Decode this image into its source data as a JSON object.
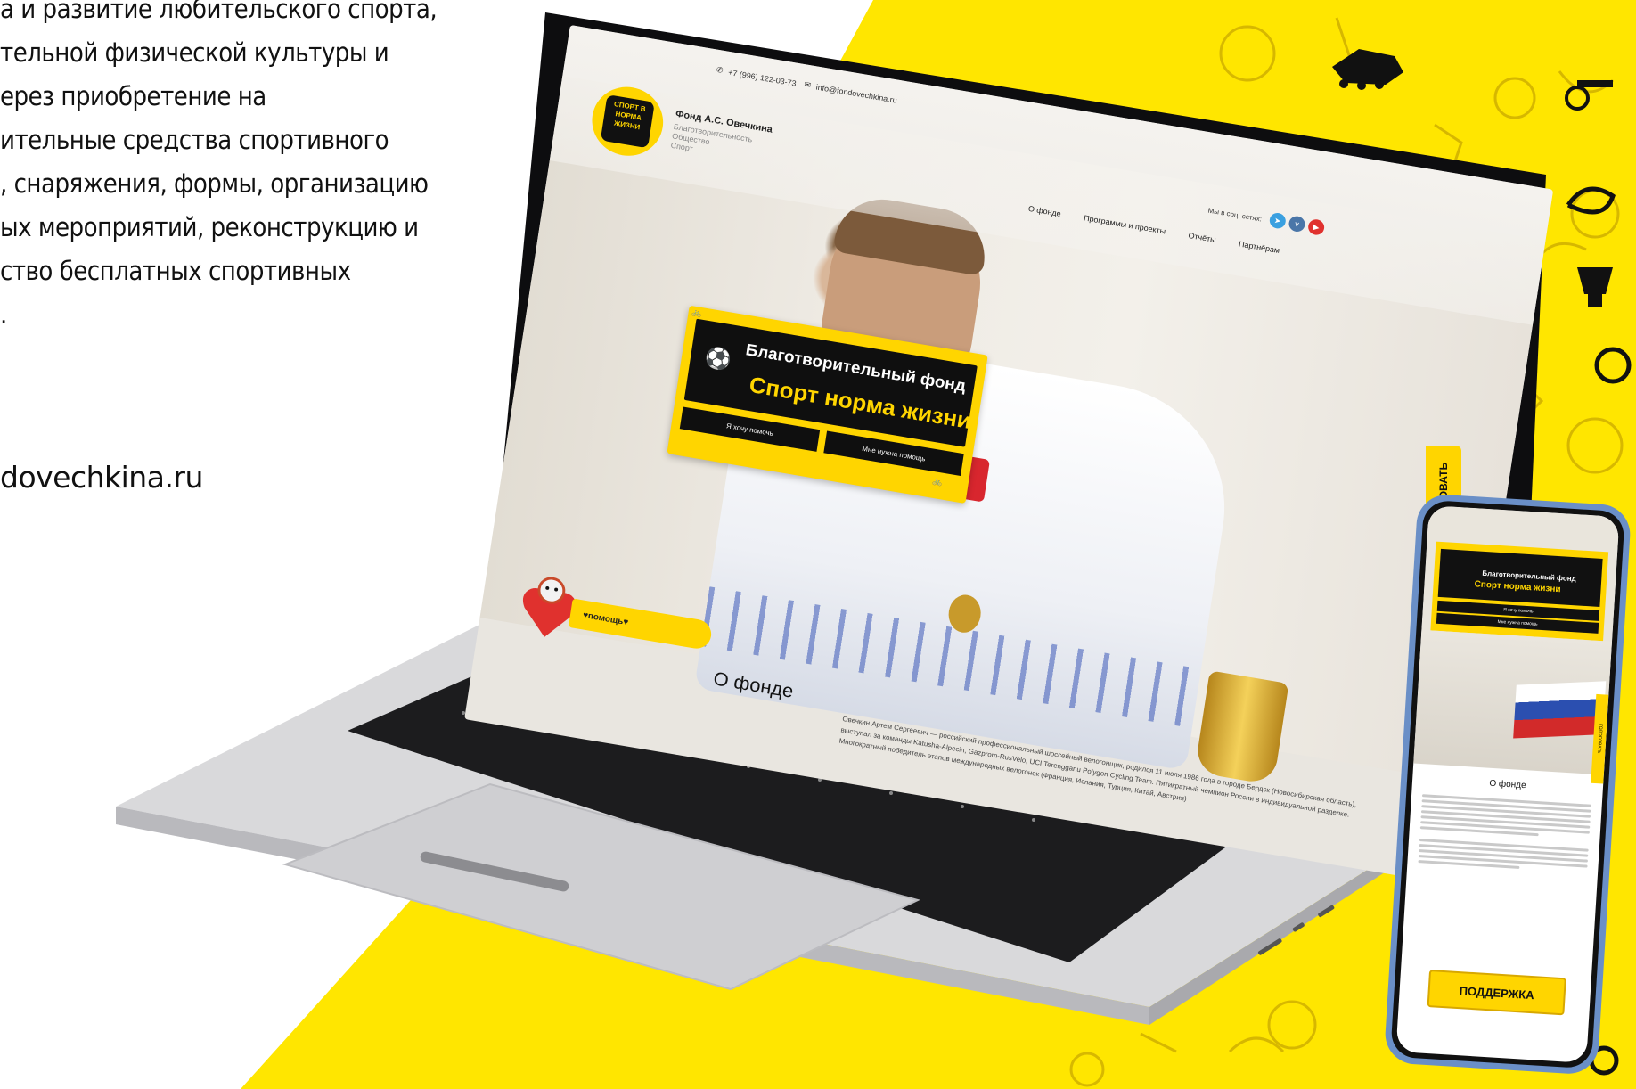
{
  "left_text": {
    "lines": [
      "а и развитие любительского спорта,",
      "тельной физической культуры и",
      "ерез приобретение на",
      "ительные средства спортивного",
      ", снаряжения, формы, организацию",
      "ых мероприятий, реконструкцию и",
      "ство бесплатных спортивных",
      "."
    ],
    "url": "dovechkina.ru"
  },
  "site": {
    "phone": "+7 (996) 122-03-73",
    "email": "info@fondovechkina.ru",
    "logo_text": "СПОРТ В НОРМА ЖИЗНИ",
    "fond_name": "Фонд А.С. Овечкина",
    "fond_sub": [
      "Благотворительность",
      "Общество",
      "Спорт"
    ],
    "social_label": "Мы в соц. сетях:",
    "nav": [
      "О фонде",
      "Программы и проекты",
      "Отчёты",
      "Партнёрам"
    ],
    "banner_title": "Благотворительный фонд",
    "banner_sub": "Спорт норма жизни",
    "btn_help": "Я хочу помочь",
    "btn_need": "Мне нужна помощь",
    "help_pill": "♥помощь♥",
    "about_title": "О фонде",
    "about_text": "Овечкин Артем Сергеевич — российский профессиональный шоссейный велогонщик, родился 11 июля 1986 года в городе Бердск (Новосибирская область), выступал за команды Katusha-Alpecin, Gazprom-RusVelo, UCI Terengganu Polygon Cycling Team. Пятикратный чемпион России в индивидуальной разделке. Многократный победитель этапов международных велогонок (Франция, Испания, Турция, Китай, Австрия)",
    "vtab": "ГОЛОСОВАТЬ"
  },
  "phone_screen": {
    "banner_title": "Благотворительный фонд",
    "banner_sub": "Спорт норма жизни",
    "btn_help": "Я хочу помочь",
    "btn_need": "Мне нужна помощь",
    "about_title": "О фонде",
    "side_tab": "ГОЛОСОВАТЬ",
    "support": "ПОДДЕРЖКА"
  },
  "colors": {
    "yellow": "#FFD500",
    "black": "#0F0F0F",
    "phone_frame": "#6A8FC7"
  }
}
